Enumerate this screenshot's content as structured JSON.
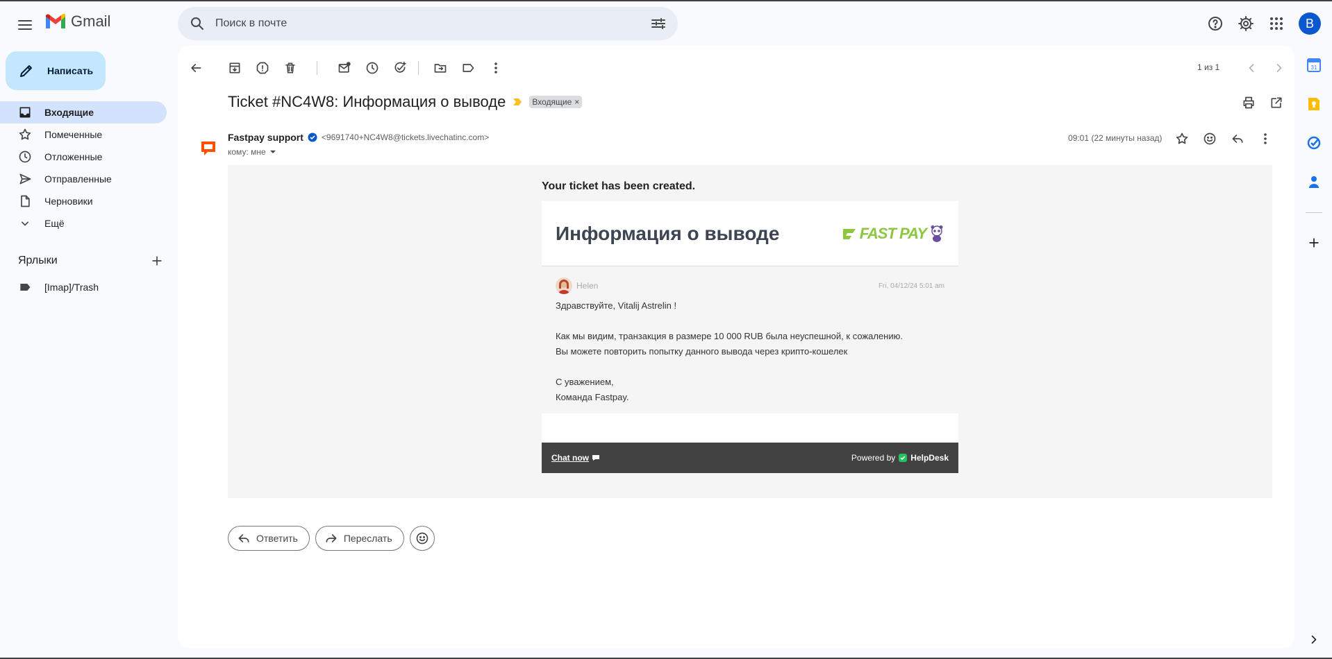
{
  "app": {
    "name": "Gmail"
  },
  "search": {
    "placeholder": "Поиск в почте"
  },
  "account": {
    "initial": "В"
  },
  "compose": {
    "label": "Написать"
  },
  "nav": {
    "items": [
      {
        "label": "Входящие",
        "icon": "inbox-icon",
        "active": true
      },
      {
        "label": "Помеченные",
        "icon": "star-icon"
      },
      {
        "label": "Отложенные",
        "icon": "clock-icon"
      },
      {
        "label": "Отправленные",
        "icon": "send-icon"
      },
      {
        "label": "Черновики",
        "icon": "draft-icon"
      },
      {
        "label": "Ещё",
        "icon": "chevron-down-icon"
      }
    ]
  },
  "labels": {
    "title": "Ярлыки",
    "items": [
      {
        "label": "[Imap]/Trash"
      }
    ]
  },
  "toolbar": {
    "pager": "1 из 1"
  },
  "message": {
    "subject": "Ticket #NC4W8: Информация о выводе",
    "label_chip": "Входящие",
    "sender_name": "Fastpay support",
    "sender_email": "<9691740+NC4W8@tickets.livechatinc.com>",
    "to": "кому: мне",
    "time": "09:01 (22 минуты назад)"
  },
  "email": {
    "created": "Your ticket has been created.",
    "card_title": "Информация о выводе",
    "logo_text": "FAST PAY",
    "agent": "Helen",
    "date": "Fri, 04/12/24 5:01 am",
    "greeting": "Здравствуйте, Vitalij Astrelin !",
    "line1": "Как мы видим, транзакция в размере 10 000 RUB была неуспешной, к сожалению.",
    "line2": "Вы можете повторить попытку данного вывода через крипто-кошелек",
    "sign1": "С уважением,",
    "sign2": "Команда Fastpay.",
    "chat_now": "Chat now",
    "powered_by": "Powered by",
    "helpdesk": "HelpDesk"
  },
  "reply": {
    "reply_label": "Ответить",
    "forward_label": "Переслать"
  },
  "colors": {
    "accent": "#0b57d0",
    "compose_bg": "#c2e7ff",
    "active_nav": "#d3e3fd",
    "livechat": "#ff5100",
    "helpdesk_green": "#21c35f"
  }
}
